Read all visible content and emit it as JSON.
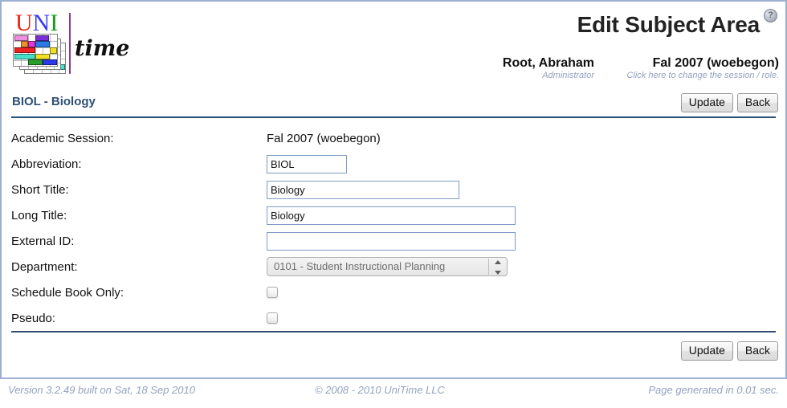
{
  "header": {
    "title": "Edit Subject Area",
    "help_icon": "help-question-icon",
    "user_name": "Root, Abraham",
    "user_role": "Administrator",
    "session_name": "Fal 2007 (woebegon)",
    "session_hint": "Click here to change the session / role.",
    "logo": {
      "uni_u": "U",
      "uni_n": "N",
      "uni_i": "I",
      "time": "time"
    }
  },
  "main": {
    "section_title": "BIOL - Biology",
    "update_label": "Update",
    "back_label": "Back",
    "fields": [
      {
        "label": "Academic Session:",
        "type": "static",
        "value": "Fal 2007 (woebegon)"
      },
      {
        "label": "Abbreviation:",
        "type": "text",
        "value": "BIOL",
        "placeholder": ""
      },
      {
        "label": "Short Title:",
        "type": "text",
        "value": "Biology",
        "placeholder": ""
      },
      {
        "label": "Long Title:",
        "type": "text",
        "value": "Biology",
        "placeholder": ""
      },
      {
        "label": "External ID:",
        "type": "text",
        "value": "",
        "placeholder": ""
      },
      {
        "label": "Department:",
        "type": "select",
        "value": "0101 - Student Instructional Planning",
        "disabled": true
      },
      {
        "label": "Schedule Book Only:",
        "type": "checkbox",
        "checked": false
      },
      {
        "label": "Pseudo:",
        "type": "checkbox",
        "checked": false
      }
    ]
  },
  "footer": {
    "version": "Version 3.2.49 built on Sat, 18 Sep 2010",
    "copyright": "© 2008 - 2010 UniTime LLC",
    "generated": "Page generated in 0.01 sec."
  },
  "colors": {
    "frame": "#9db0d3",
    "rule": "#2d4f75",
    "section_title": "#2d4f75",
    "footer_text": "#93a2c0",
    "input_border": "#7f9bc4"
  }
}
